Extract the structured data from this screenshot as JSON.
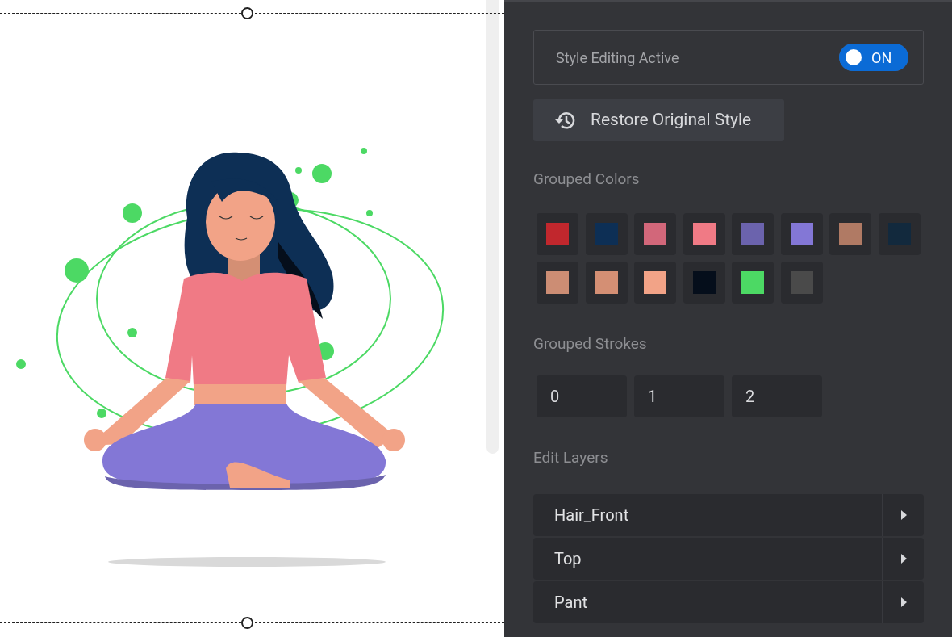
{
  "style_toggle": {
    "label": "Style Editing Active",
    "on": true,
    "state_text": "ON"
  },
  "restore_button": {
    "label": "Restore Original Style"
  },
  "grouped_colors": {
    "title": "Grouped Colors",
    "swatches": [
      {
        "color": "#c1272d"
      },
      {
        "color": "#0d2f55"
      },
      {
        "color": "#d2677a"
      },
      {
        "color": "#f07a85"
      },
      {
        "color": "#6b63ad"
      },
      {
        "color": "#8377d6"
      },
      {
        "color": "#b07a64"
      },
      {
        "color": "#12293d"
      },
      {
        "color": "#cc8d74"
      },
      {
        "color": "#d48f74"
      },
      {
        "color": "#f2a387"
      },
      {
        "color": "#050e1b"
      },
      {
        "color": "#4cd964"
      },
      {
        "color": "#4a4a4a"
      }
    ]
  },
  "grouped_strokes": {
    "title": "Grouped Strokes",
    "values": [
      "0",
      "1",
      "2"
    ]
  },
  "edit_layers": {
    "title": "Edit Layers",
    "layers": [
      {
        "name": "Hair_Front",
        "expanded": false
      },
      {
        "name": "Top",
        "expanded": false
      },
      {
        "name": "Pant",
        "expanded": false
      }
    ]
  }
}
